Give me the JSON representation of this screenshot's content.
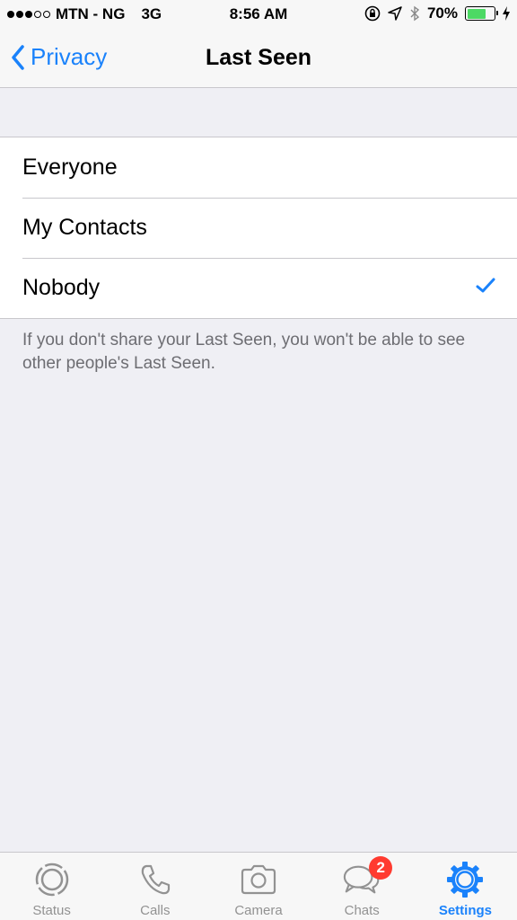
{
  "status_bar": {
    "carrier": "MTN - NG",
    "network": "3G",
    "time": "8:56 AM",
    "battery": "70%",
    "battery_level": 0.7
  },
  "nav": {
    "back_label": "Privacy",
    "title": "Last Seen"
  },
  "options": [
    {
      "label": "Everyone",
      "selected": false
    },
    {
      "label": "My Contacts",
      "selected": false
    },
    {
      "label": "Nobody",
      "selected": true
    }
  ],
  "footer_note": "If you don't share your Last Seen, you won't be able to see other people's Last Seen.",
  "tabs": [
    {
      "label": "Status",
      "icon": "status-icon"
    },
    {
      "label": "Calls",
      "icon": "phone-icon"
    },
    {
      "label": "Camera",
      "icon": "camera-icon"
    },
    {
      "label": "Chats",
      "icon": "chats-icon",
      "badge": "2"
    },
    {
      "label": "Settings",
      "icon": "gear-icon",
      "active": true
    }
  ],
  "colors": {
    "accent": "#1a82fb",
    "badge": "#ff3b30",
    "battery": "#4cd964",
    "inactive": "#929292"
  }
}
